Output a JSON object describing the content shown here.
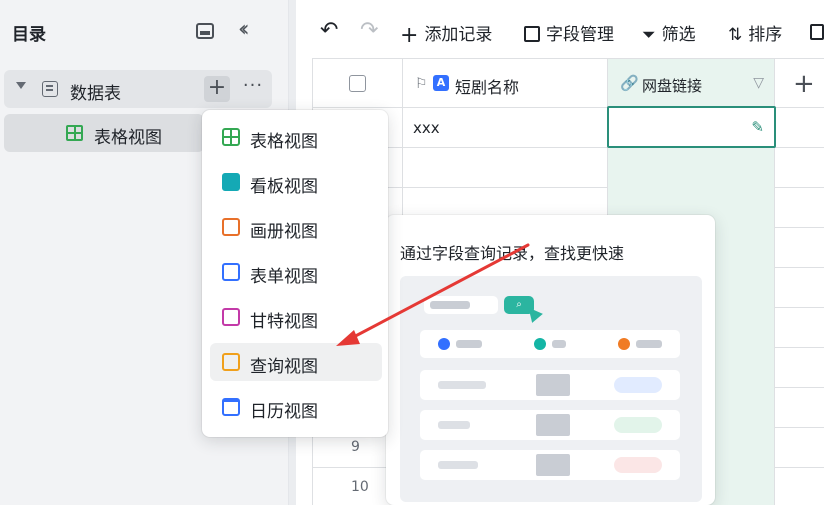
{
  "sidebar": {
    "title": "目录",
    "tree": {
      "database_label": "数据表",
      "plus_glyph": "+",
      "more_glyph": "···",
      "view_label": "表格视图"
    }
  },
  "toolbar": {
    "add_record": "添加记录",
    "field_manage": "字段管理",
    "filter": "筛选",
    "sort": "排序"
  },
  "table": {
    "columns": [
      {
        "label": "短剧名称",
        "type": "text"
      },
      {
        "label": "网盘链接",
        "type": "link"
      }
    ],
    "rows": [
      {
        "num": "",
        "name": "xxx"
      },
      {
        "num": "",
        "name": ""
      },
      {
        "num": "",
        "name": ""
      },
      {
        "num": "",
        "name": ""
      },
      {
        "num": "",
        "name": ""
      },
      {
        "num": "",
        "name": ""
      },
      {
        "num": "",
        "name": ""
      },
      {
        "num": "",
        "name": ""
      },
      {
        "num": "9",
        "name": ""
      },
      {
        "num": "10",
        "name": ""
      }
    ]
  },
  "menu": {
    "items": [
      {
        "label": "表格视图",
        "icon": "grid-view-icon",
        "color": "#34a853"
      },
      {
        "label": "看板视图",
        "icon": "kanban-view-icon",
        "color": "#14a9b5"
      },
      {
        "label": "画册视图",
        "icon": "gallery-view-icon",
        "color": "#e8702a"
      },
      {
        "label": "表单视图",
        "icon": "form-view-icon",
        "color": "#3370ff"
      },
      {
        "label": "甘特视图",
        "icon": "gantt-view-icon",
        "color": "#c33aa8"
      },
      {
        "label": "查询视图",
        "icon": "query-view-icon",
        "color": "#f0a01c"
      },
      {
        "label": "日历视图",
        "icon": "calendar-view-icon",
        "color": "#3370ff"
      }
    ],
    "highlighted_index": 5
  },
  "preview": {
    "title": "通过字段查询记录，查找更快速"
  },
  "colors": {
    "accent": "#2a8f7a",
    "link_column_bg": "#e8f4ef",
    "arrow": "#e53935"
  }
}
